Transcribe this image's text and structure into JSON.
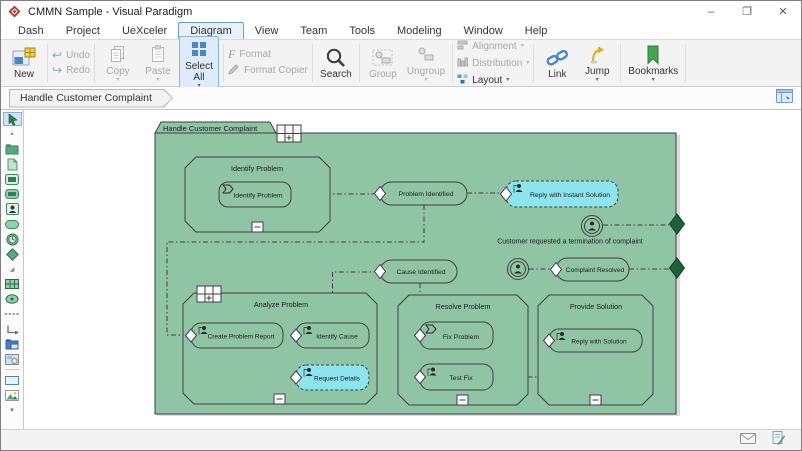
{
  "window": {
    "title": "CMMN Sample - Visual Paradigm",
    "minimize": "–",
    "maximize": "❐",
    "close": "✕"
  },
  "menu": {
    "items": [
      "Dash",
      "Project",
      "UeXceler",
      "Diagram",
      "View",
      "Team",
      "Tools",
      "Modeling",
      "Window",
      "Help"
    ],
    "active": "Diagram"
  },
  "ribbon": {
    "new": "New",
    "undo": "Undo",
    "redo": "Redo",
    "copy": "Copy",
    "paste": "Paste",
    "select_all": "Select All",
    "format": "Format",
    "format_copier": "Format Copier",
    "search": "Search",
    "group": "Group",
    "ungroup": "Ungroup",
    "alignment": "Alignment",
    "distribution": "Distribution",
    "layout": "Layout",
    "link": "Link",
    "jump": "Jump",
    "bookmarks": "Bookmarks"
  },
  "breadcrumb": {
    "label": "Handle Customer Complaint"
  },
  "palette": {
    "items": [
      "pointer-tool",
      "collapse-handle",
      "folder",
      "diagram-page",
      "stage",
      "task",
      "case-role",
      "milestone",
      "timer-event",
      "sentry",
      "more-corner",
      "planning-table",
      "event-listener",
      "dashed-connector",
      "elbow-connector",
      "model-folder",
      "overview",
      "rectangle",
      "image",
      "scroll-down"
    ]
  },
  "diagram": {
    "case_plan_title": "Handle Customer Complaint",
    "stage_identify_problem": "Identify Problem",
    "task_identify_problem": "Identify Problem",
    "milestone_problem_identified": "Problem Identified",
    "task_reply_instant_solution": "Reply with Instant Solution",
    "event_termination": "Customer requested a termination of complaint",
    "milestone_cause_identified": "Cause Identified",
    "milestone_complaint_resolved": "Complaint Resolved",
    "stage_analyze_problem": "Analyze Problem",
    "task_create_problem_report": "Create Problem Report",
    "task_identify_cause": "Identify Cause",
    "task_request_details": "Request Details",
    "stage_resolve_problem": "Resolve Problem",
    "task_fix_problem": "Fix Problem",
    "task_test_fix": "Test Fix",
    "stage_provide_solution": "Provide Solution",
    "task_reply_with_solution": "Reply with Solution",
    "colors": {
      "case_fill": "#8fc5a4",
      "discretionary_fill": "#8ce4ef",
      "exit_diamond": "#1f5f3c",
      "outline": "#3f3f3f"
    }
  }
}
